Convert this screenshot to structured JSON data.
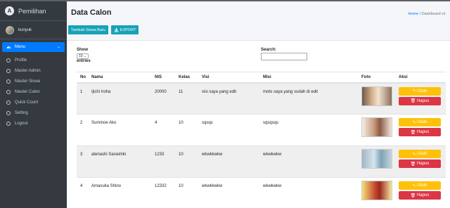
{
  "app": {
    "brand": "Pemilihan",
    "user": "kunyuk"
  },
  "colors": {
    "sidebar": "#343a40",
    "primary": "#007bff",
    "info": "#17a2b8",
    "warning": "#ffc107",
    "danger": "#dc3545"
  },
  "sidebar": {
    "menu_label": "Menu",
    "items": [
      "Profile",
      "Master Admin",
      "Master Siswa",
      "Master Calon",
      "Quick Count",
      "Setting",
      "Logout"
    ]
  },
  "header": {
    "title": "Data Calon",
    "breadcrumb_home": "Home",
    "breadcrumb_sep": "/",
    "breadcrumb_current": "Dashboard v1"
  },
  "toolbar": {
    "add_label": "Tambah Siswa Baru",
    "export_label": "EXPORT"
  },
  "table_controls": {
    "show_label": "Show",
    "entries_value": "10",
    "entries_label": "entries",
    "search_label": "Search:",
    "search_value": ""
  },
  "table": {
    "headers": [
      "No",
      "Nama",
      "NIS",
      "Kelas",
      "Visi",
      "Misi",
      "Foto",
      "Aksi"
    ],
    "rows": [
      {
        "no": "1",
        "nama": "Ijichi Iroha",
        "nis": "20000",
        "kelas": "11",
        "visi": "visi saya yang edit",
        "misi": "moto saya yang sudah di edit"
      },
      {
        "no": "2",
        "nama": "Suminoe Ako",
        "nis": "4",
        "kelas": "10",
        "visi": "sqsqs",
        "misi": "sqsqsqs"
      },
      {
        "no": "3",
        "nama": "atenashi Sarashiki",
        "nis": "1233",
        "kelas": "10",
        "visi": "wkwkkwkw",
        "misi": "wkwkwkw"
      },
      {
        "no": "4",
        "nama": "Amasuka Shino",
        "nis": "12332",
        "kelas": "10",
        "visi": "wkwkkwkw",
        "misi": "wkwkwkw"
      }
    ],
    "edit_label": "Ubah",
    "delete_label": "Hapus"
  }
}
